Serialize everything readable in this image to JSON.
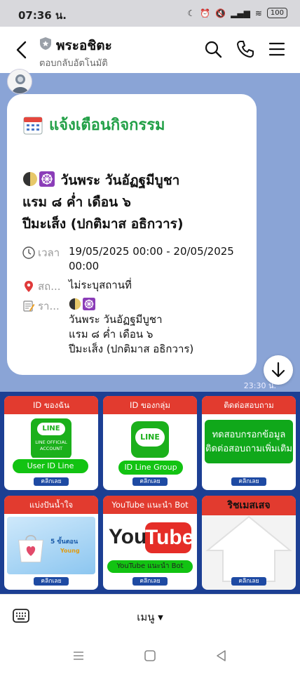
{
  "status": {
    "time": "07:36 น.",
    "battery": "100"
  },
  "header": {
    "title": "พระอชิตะ",
    "subtitle": "ตอบกลับอัตโนมัติ"
  },
  "message": {
    "title": "แจ้งเตือนกิจกรรม",
    "heading_line1": "วันพระ วันอัฏฐมีบูชา",
    "heading_line2": "แรม ๘ ค่ำ เดือน ๖",
    "heading_line3": "ปีมะเส็ง (ปกติมาส อธิกวาร)",
    "time_label": "เวลา",
    "time_value": "19/05/2025 00:00 - 20/05/2025 00:00",
    "place_label": "สถ...",
    "place_value": "ไม่ระบุสถานที่",
    "detail_label": "รา...",
    "detail_line1": "วันพระ วันอัฏฐมีบูชา",
    "detail_line2": "แรม ๘ ค่ำ เดือน ๖",
    "detail_line3": "ปีมะเส็ง (ปกติมาส อธิกวาร)",
    "timestamp": "23:30 น."
  },
  "rich_menu": {
    "tiles": [
      {
        "head": "ID ของฉัน",
        "card_line1": "LINE",
        "card_line2": "LINE OFFICIAL",
        "card_line3": "ACCOUNT",
        "pill": "User ID Line",
        "button": "คลิกเลย"
      },
      {
        "head": "ID ของกลุ่ม",
        "card_line1": "LINE",
        "pill": "ID Line Group",
        "button": "คลิกเลย"
      },
      {
        "head": "ติดต่อสอบถาม",
        "card_line1": "ทดสอบกรอกข้อมูล",
        "card_line2": "ติดต่อสอบถามเพิ่มเติม",
        "button": "คลิกเลย"
      },
      {
        "head": "แบ่งปันน้ำใจ",
        "card_line1": "5 ขั้นตอน",
        "card_line2": "Young",
        "button": "คลิกเลย"
      },
      {
        "head": "YouTube แนะนำ Bot",
        "card_line1": "You",
        "card_line2": "Tube",
        "pill": "YouTube แนะนำ Bot",
        "button": "คลิกเลย"
      },
      {
        "head": "ริชเมสเสจ",
        "button": "คลิกเลย"
      }
    ]
  },
  "bottom": {
    "menu_label": "เมนู ▾"
  }
}
